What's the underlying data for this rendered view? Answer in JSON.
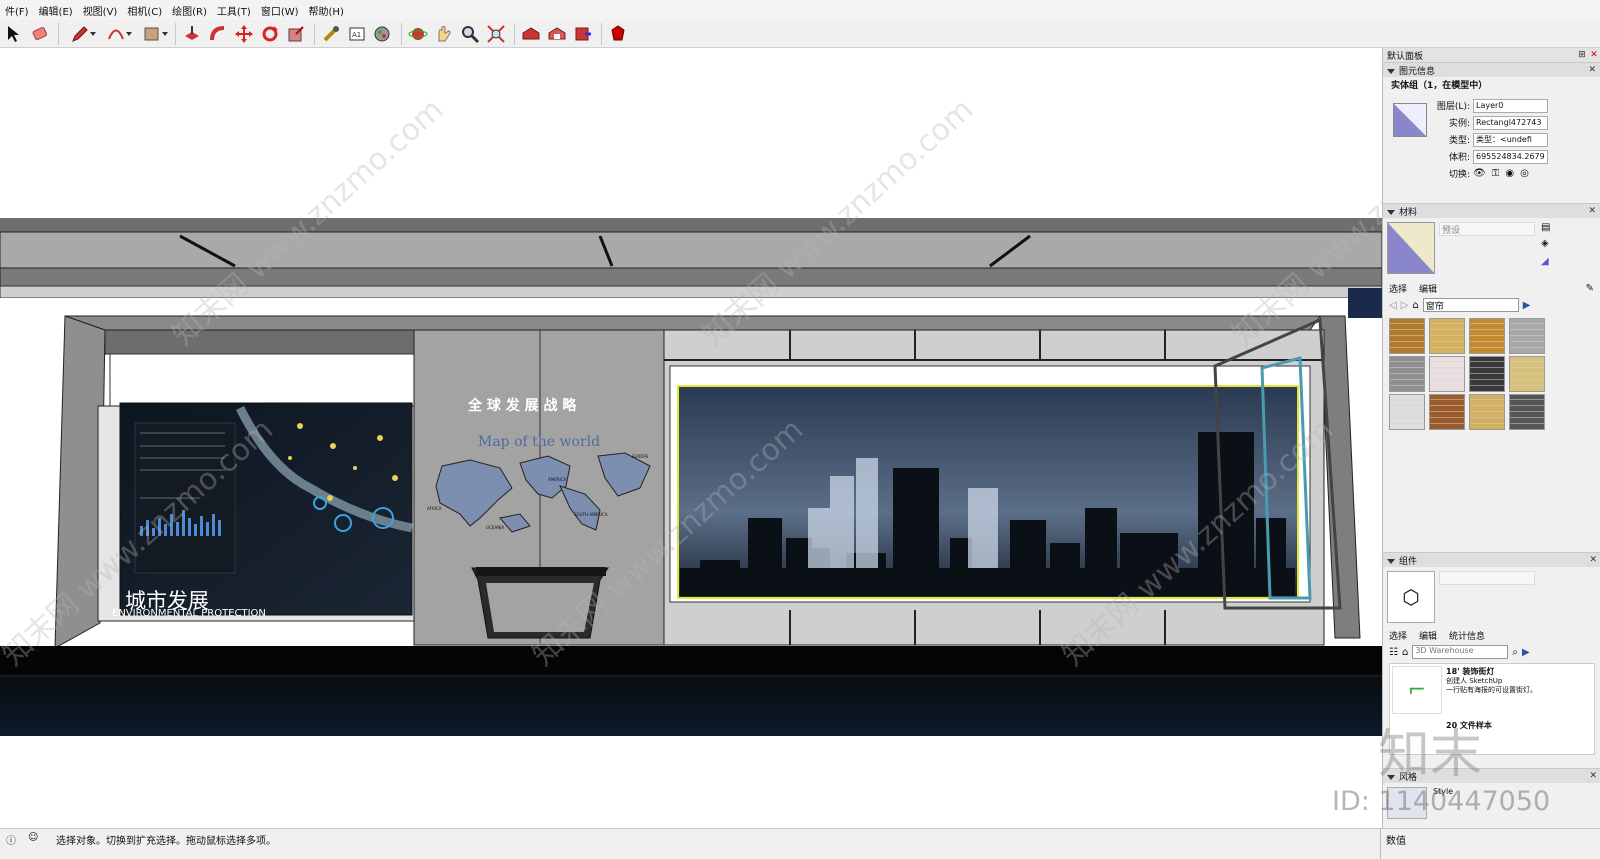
{
  "menu": [
    "件(F)",
    "编辑(E)",
    "视图(V)",
    "相机(C)",
    "绘图(R)",
    "工具(T)",
    "窗口(W)",
    "帮助(H)"
  ],
  "toolbar": {
    "icons": [
      "select-icon",
      "eraser-icon",
      "pencil-icon",
      "arc-icon",
      "rectangle-icon",
      "push-pull-icon",
      "follow-me-icon",
      "move-icon",
      "rotate-icon",
      "scale-icon",
      "tape-measure-icon",
      "text-icon",
      "paint-bucket-icon",
      "orbit-icon",
      "pan-icon",
      "zoom-icon",
      "zoom-extents-icon",
      "warehouse-icon",
      "share-model-icon",
      "extension-icon",
      "ruby-icon"
    ]
  },
  "scene": {
    "title_cn": "全 球 发 展 战 略",
    "map_title": "Map of the world",
    "panel_cn": "城市发展",
    "panel_en": "ENVIRONMENTAL PROTECTION",
    "continents": [
      "AFRICA",
      "AMERICA",
      "OCEANIA",
      "SOUTH AMERICA",
      "EUROPE"
    ],
    "watermark": "知末网 www.znzmo.com"
  },
  "tray": {
    "title": "默认面板",
    "entity_info": {
      "header": "图元信息",
      "subtitle": "实体组（1，在模型中）",
      "layer_label": "图层(L):",
      "layer_value": "Layer0",
      "instance_label": "实例:",
      "instance_value": "Rectangl472743",
      "type_label": "类型:",
      "type_value": "类型：<undefi",
      "volume_label": "体积:",
      "volume_value": "695524834.2679 m",
      "toggle_label": "切换:"
    },
    "materials": {
      "header": "材料",
      "preset": "预设",
      "tab_select": "选择",
      "tab_edit": "编辑",
      "library": "窗帘",
      "colors": [
        "#b07a2a",
        "#d4b15a",
        "#c48a2e",
        "#a8a8a8",
        "#8f8f8f",
        "#e8e0e0",
        "#3a3a3a",
        "#d8c27a",
        "#dedede",
        "#9a5a2a",
        "#d2b060",
        "#555555"
      ]
    },
    "components": {
      "header": "组件",
      "tab_select": "选择",
      "tab_edit": "编辑",
      "tab_stats": "统计信息",
      "search_placeholder": "3D Warehouse",
      "item1_title": "18' 装饰街灯",
      "item1_by": "创建人 SketchUp",
      "item1_desc": "一行贴有海报的可设置街灯。",
      "item2_title": "20 文件样本"
    },
    "styles": {
      "header": "风格",
      "entry": "Style"
    }
  },
  "status": {
    "message": "选择对象。切换到扩充选择。拖动鼠标选择多项。",
    "value_label": "数值"
  },
  "overlay": {
    "id_text": "ID: 1140447050",
    "brand_text": "知末"
  }
}
